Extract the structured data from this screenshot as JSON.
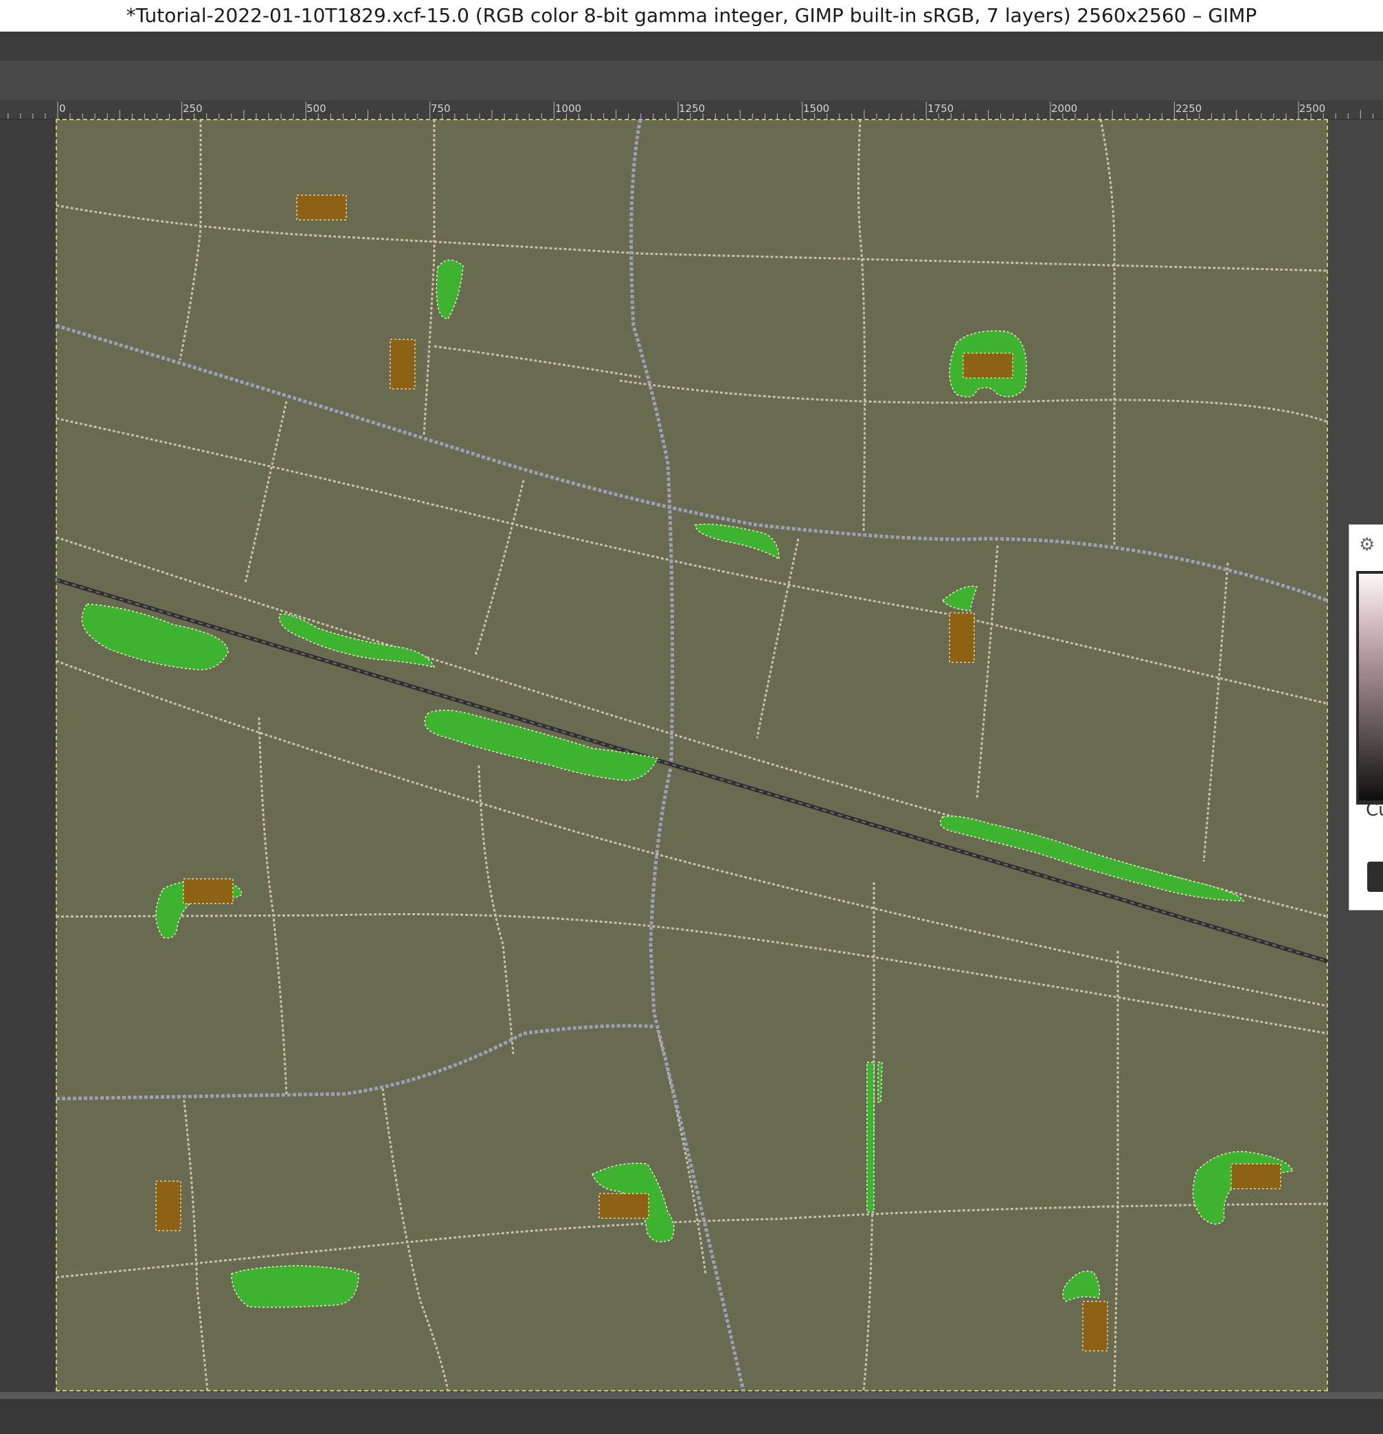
{
  "window": {
    "title": "*Tutorial-2022-01-10T1829.xcf-15.0 (RGB color 8-bit gamma integer, GIMP built-in sRGB, 7 layers) 2560x2560 – GIMP"
  },
  "ruler": {
    "labels": [
      "0",
      "250",
      "500",
      "750",
      "1000",
      "1250",
      "1500",
      "1750",
      "2000",
      "2250",
      "2500"
    ]
  },
  "canvas": {
    "background": "#696b50",
    "road_color": "#c8bfae",
    "highway_color": "#9aa0b6",
    "railway_color": "#2f2f2f",
    "park_color": "#3db32f",
    "building_color": "#8e6214"
  },
  "side_panel": {
    "label": "Cu",
    "icon": "gimp-wilber-icon"
  },
  "statusbar": {
    "text": ")"
  }
}
